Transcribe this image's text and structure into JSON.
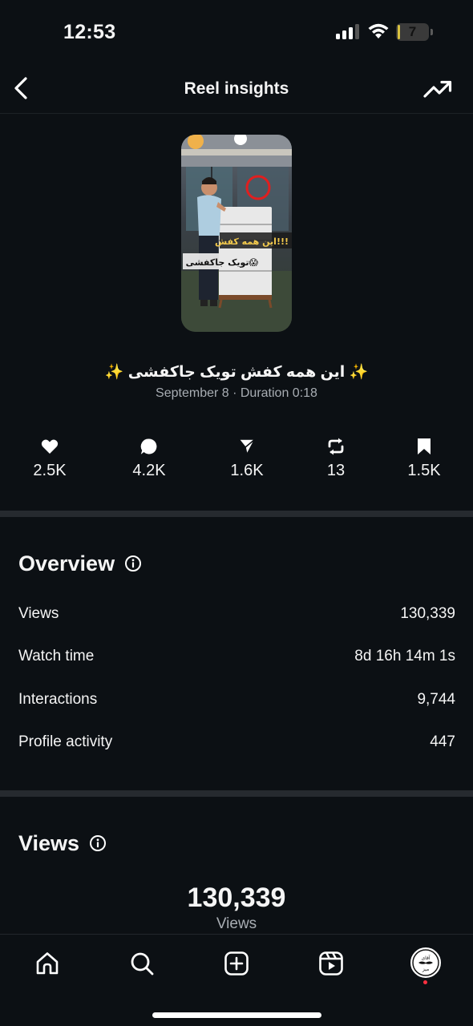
{
  "status_bar": {
    "time": "12:53",
    "battery_level": "7",
    "battery_fraction": 0.07
  },
  "header": {
    "title": "Reel insights",
    "back_icon": "chevron-left-icon",
    "action_icon": "trending-up-icon"
  },
  "reel": {
    "overlay_text_1": "این همه کفش!!!",
    "overlay_text_2": "تویک جاکفشی😱",
    "caption": "✨ این همه کفش تویک جاکفشی ✨",
    "meta": "September 8 · Duration 0:18"
  },
  "stats": [
    {
      "icon": "heart-icon",
      "value": "2.5K"
    },
    {
      "icon": "comment-icon",
      "value": "4.2K"
    },
    {
      "icon": "share-icon",
      "value": "1.6K"
    },
    {
      "icon": "repost-icon",
      "value": "13"
    },
    {
      "icon": "bookmark-icon",
      "value": "1.5K"
    }
  ],
  "overview": {
    "title": "Overview",
    "rows": [
      {
        "label": "Views",
        "value": "130,339"
      },
      {
        "label": "Watch time",
        "value": "8d 16h 14m 1s"
      },
      {
        "label": "Interactions",
        "value": "9,744"
      },
      {
        "label": "Profile activity",
        "value": "447"
      }
    ]
  },
  "views_section": {
    "title": "Views",
    "total": "130,339",
    "total_label": "Views"
  },
  "bottom_nav": {
    "items": [
      "home-icon",
      "search-icon",
      "create-icon",
      "reels-icon",
      "profile-avatar"
    ],
    "avatar_text_1": "آقای",
    "avatar_text_2": "میز"
  },
  "colors": {
    "background": "#0c1014",
    "divider": "#262a2f",
    "muted_text": "#a8adb3",
    "notification_dot": "#ff3040"
  }
}
